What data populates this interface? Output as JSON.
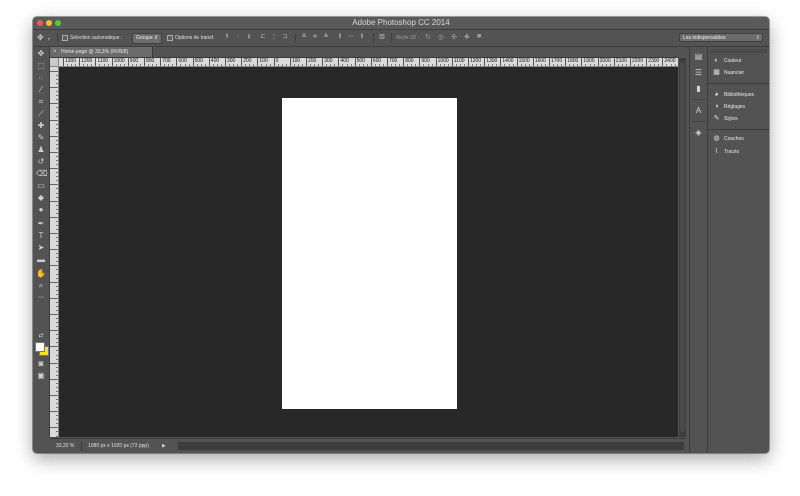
{
  "app": {
    "title": "Adobe Photoshop CC 2014"
  },
  "options_bar": {
    "auto_select_label": "Sélection automatique :",
    "auto_select_value": "Groupe",
    "transform_controls_label": "Options de transf.",
    "mode_3d_label": "Mode 3D :",
    "workspace": "Les indispensables"
  },
  "document": {
    "tab_title": "Home-page @ 33,3% (RVB/8)",
    "close_glyph": "×"
  },
  "rulers": {
    "horizontal_labels": [
      "1300",
      "1200",
      "1100",
      "1000",
      "900",
      "800",
      "700",
      "600",
      "500",
      "400",
      "300",
      "200",
      "100",
      "0",
      "100",
      "200",
      "300",
      "400",
      "500",
      "600",
      "700",
      "800",
      "900",
      "1000",
      "1100",
      "1200",
      "1300",
      "1400",
      "1500",
      "1600",
      "1700",
      "1800",
      "1900",
      "2000",
      "2100",
      "2200",
      "2300",
      "2400"
    ]
  },
  "status_bar": {
    "zoom": "33,33 %",
    "doc_info": "1080 px x 1920 px (72 ppp)"
  },
  "panels": {
    "items": [
      {
        "label": "Couleur",
        "icon": "color-wheel-icon",
        "glyph": "◐"
      },
      {
        "label": "Nuancier",
        "icon": "swatches-grid-icon",
        "glyph": "▦"
      },
      {
        "label": "Bibliothèques",
        "icon": "libraries-icon",
        "glyph": "◕"
      },
      {
        "label": "Réglages",
        "icon": "adjustments-icon",
        "glyph": "◑"
      },
      {
        "label": "Styles",
        "icon": "styles-icon",
        "glyph": "✎"
      },
      {
        "label": "Couches",
        "icon": "channels-icon",
        "glyph": "◍"
      },
      {
        "label": "Tracés",
        "icon": "paths-icon",
        "glyph": "⌇"
      }
    ]
  },
  "colors": {
    "foreground": "#ffffff",
    "background": "#f5e21b",
    "canvas_bg": "#282828",
    "ui_gray": "#535353"
  }
}
